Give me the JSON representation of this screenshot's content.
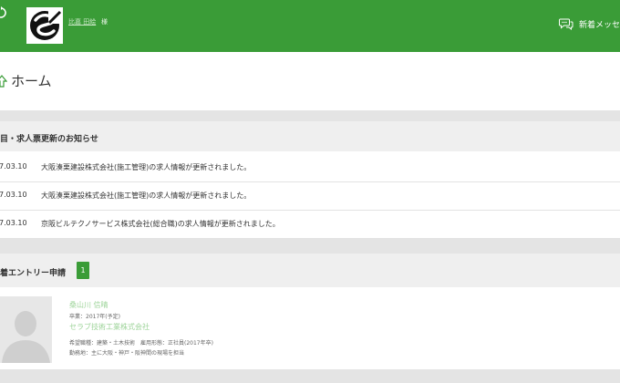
{
  "header": {
    "user_name": "比嘉 田絵",
    "user_suffix": "様",
    "messages_label": "新着メッセー..."
  },
  "page": {
    "title": "ホーム"
  },
  "notices": {
    "heading": "目・求人票更新のお知らせ",
    "items": [
      {
        "date": "7.03.10",
        "text": "大阪湊栗建設株式会社(施工管理)の求人情報が更新されました。"
      },
      {
        "date": "7.03.10",
        "text": "大阪湊栗建設株式会社(施工管理)の求人情報が更新されました。"
      },
      {
        "date": "7.03.10",
        "text": "京阪ビルテクノサービス株式会社(総合職)の求人情報が更新されました。"
      }
    ]
  },
  "entries": {
    "heading": "着エントリー申請",
    "count": "1",
    "card": {
      "name": "桑山川 信晴",
      "sub": "卒業：2017年(予定)",
      "company": "セラブ技術工業株式会社",
      "meta_1": "希望職種：建築・土木技術　雇用形態：正社員(2017年卒)",
      "meta_2": "勤務地：主に大阪・神戸・阪神間の現場を担当"
    }
  },
  "colors": {
    "brand_green": "#3a9c37",
    "link_green": "#9ed49a"
  },
  "icons": {
    "menu": "refresh-circle-icon",
    "home": "home-arrow-icon",
    "messages": "chat-bubbles-icon",
    "logo": "company-logo"
  }
}
